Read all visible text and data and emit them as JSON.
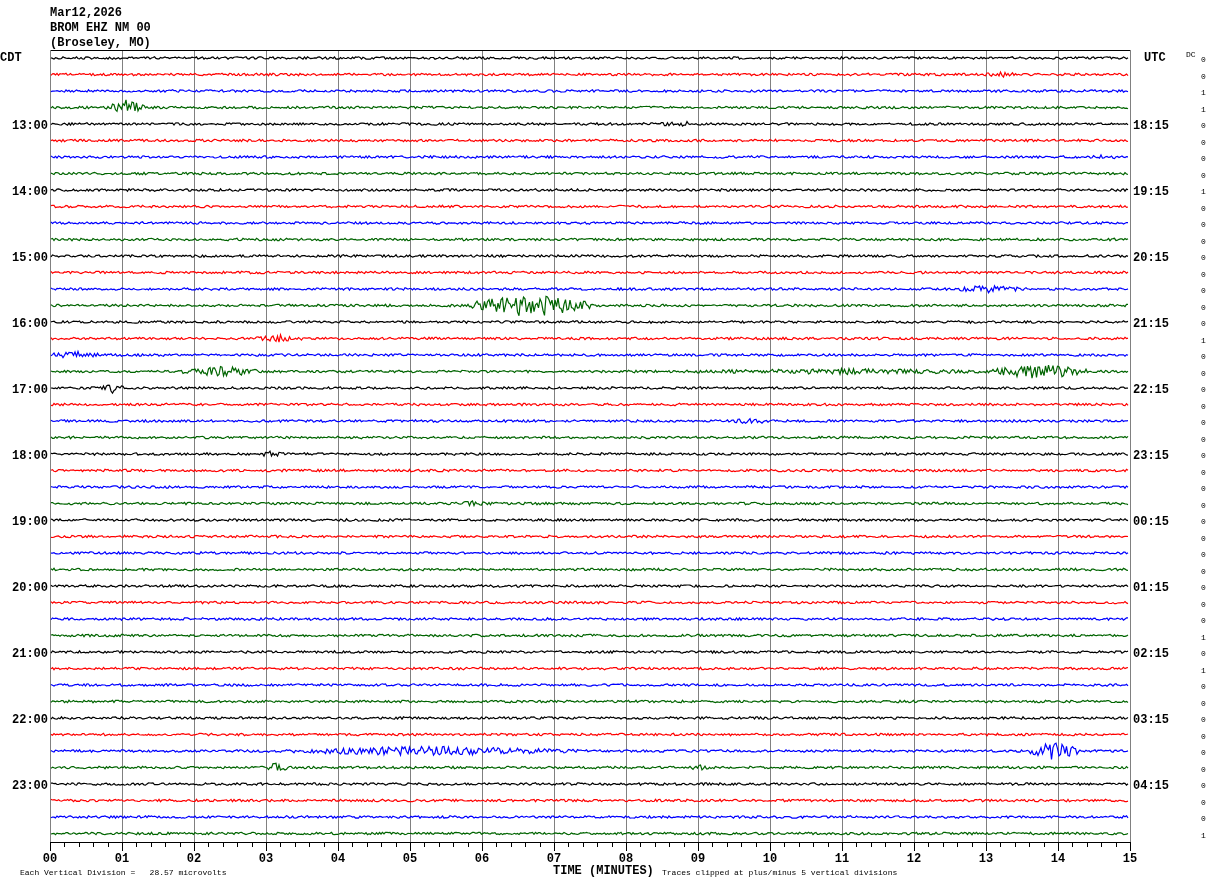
{
  "header": {
    "date": "Mar12,2026",
    "station": "BROM EHZ NM 00",
    "location": "(Broseley, MO)"
  },
  "left_timezone": "CDT",
  "right_timezone": "UTC",
  "dc_heading": "DC",
  "traces": [
    {
      "color": "#000000",
      "dc": "0"
    },
    {
      "color": "#ff0000",
      "dc": "0"
    },
    {
      "color": "#0000ff",
      "dc": "1"
    },
    {
      "color": "#006400",
      "dc": "1"
    },
    {
      "color": "#000000",
      "dc": "0",
      "cdt": "13:00",
      "utc": "18:15"
    },
    {
      "color": "#ff0000",
      "dc": "0"
    },
    {
      "color": "#0000ff",
      "dc": "0"
    },
    {
      "color": "#006400",
      "dc": "0"
    },
    {
      "color": "#000000",
      "dc": "1",
      "cdt": "14:00",
      "utc": "19:15"
    },
    {
      "color": "#ff0000",
      "dc": "0"
    },
    {
      "color": "#0000ff",
      "dc": "0"
    },
    {
      "color": "#006400",
      "dc": "0"
    },
    {
      "color": "#000000",
      "dc": "0",
      "cdt": "15:00",
      "utc": "20:15"
    },
    {
      "color": "#ff0000",
      "dc": "0"
    },
    {
      "color": "#0000ff",
      "dc": "0"
    },
    {
      "color": "#006400",
      "dc": "0"
    },
    {
      "color": "#000000",
      "dc": "0",
      "cdt": "16:00",
      "utc": "21:15"
    },
    {
      "color": "#ff0000",
      "dc": "1"
    },
    {
      "color": "#0000ff",
      "dc": "0"
    },
    {
      "color": "#006400",
      "dc": "0"
    },
    {
      "color": "#000000",
      "dc": "0",
      "cdt": "17:00",
      "utc": "22:15"
    },
    {
      "color": "#ff0000",
      "dc": "0"
    },
    {
      "color": "#0000ff",
      "dc": "0"
    },
    {
      "color": "#006400",
      "dc": "0"
    },
    {
      "color": "#000000",
      "dc": "0",
      "cdt": "18:00",
      "utc": "23:15"
    },
    {
      "color": "#ff0000",
      "dc": "0"
    },
    {
      "color": "#0000ff",
      "dc": "0"
    },
    {
      "color": "#006400",
      "dc": "0"
    },
    {
      "color": "#000000",
      "dc": "0",
      "cdt": "19:00",
      "utc": "00:15"
    },
    {
      "color": "#ff0000",
      "dc": "0"
    },
    {
      "color": "#0000ff",
      "dc": "0"
    },
    {
      "color": "#006400",
      "dc": "0"
    },
    {
      "color": "#000000",
      "dc": "0",
      "cdt": "20:00",
      "utc": "01:15"
    },
    {
      "color": "#ff0000",
      "dc": "0"
    },
    {
      "color": "#0000ff",
      "dc": "0"
    },
    {
      "color": "#006400",
      "dc": "1"
    },
    {
      "color": "#000000",
      "dc": "0",
      "cdt": "21:00",
      "utc": "02:15"
    },
    {
      "color": "#ff0000",
      "dc": "1"
    },
    {
      "color": "#0000ff",
      "dc": "0"
    },
    {
      "color": "#006400",
      "dc": "0"
    },
    {
      "color": "#000000",
      "dc": "0",
      "cdt": "22:00",
      "utc": "03:15"
    },
    {
      "color": "#ff0000",
      "dc": "0"
    },
    {
      "color": "#0000ff",
      "dc": "0"
    },
    {
      "color": "#006400",
      "dc": "0"
    },
    {
      "color": "#000000",
      "dc": "0",
      "cdt": "23:00",
      "utc": "04:15"
    },
    {
      "color": "#ff0000",
      "dc": "0"
    },
    {
      "color": "#0000ff",
      "dc": "0"
    },
    {
      "color": "#006400",
      "dc": "1"
    }
  ],
  "x_axis": {
    "ticks": [
      "00",
      "01",
      "02",
      "03",
      "04",
      "05",
      "06",
      "07",
      "08",
      "09",
      "10",
      "11",
      "12",
      "13",
      "14",
      "15"
    ],
    "title": "TIME (MINUTES)"
  },
  "footer": {
    "scale_note": "Each Vertical Division =   28.57 microvolts",
    "clip_note": "Traces clipped at plus/minus 5 vertical divisions"
  }
}
